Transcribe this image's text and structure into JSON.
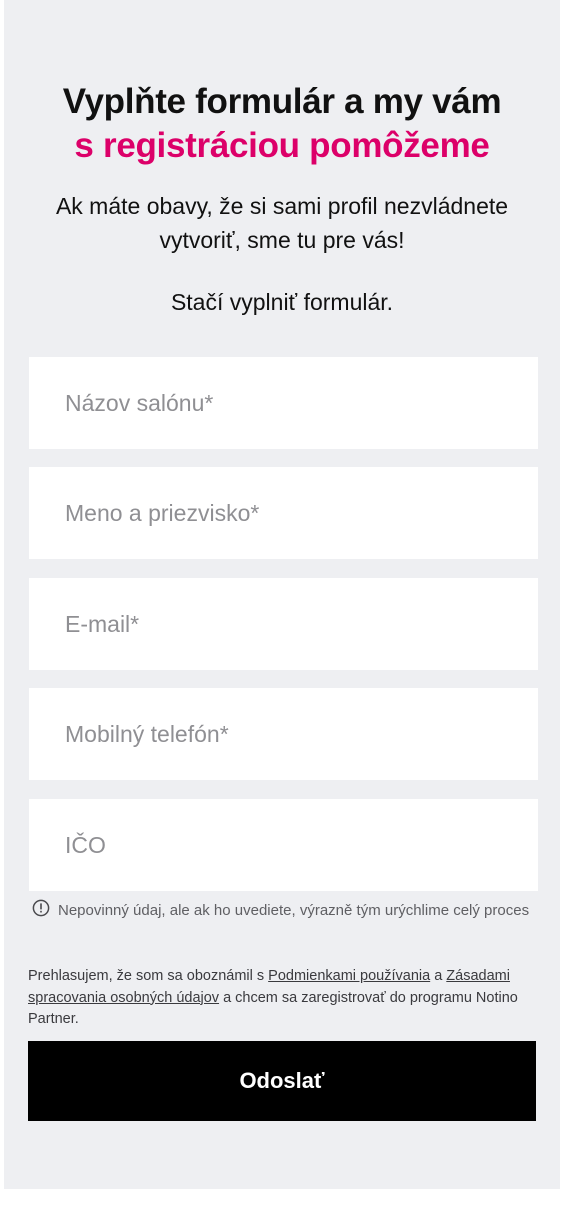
{
  "heading": {
    "line1": "Vyplňte formulár a my vám",
    "line2": "s registráciou pomôžeme"
  },
  "intro": "Ak máte obavy, že si sami profil nezvládnete vytvoriť, sme tu pre vás!",
  "cta": "Stačí vyplniť formulár.",
  "form": {
    "salon_name": {
      "placeholder": "Názov salónu*",
      "value": ""
    },
    "full_name": {
      "placeholder": "Meno a priezvisko*",
      "value": ""
    },
    "email": {
      "placeholder": "E-mail*",
      "value": ""
    },
    "phone": {
      "placeholder": "Mobilný telefón*",
      "value": ""
    },
    "ico": {
      "placeholder": "IČO",
      "value": ""
    }
  },
  "hint": {
    "icon": "info-icon",
    "text": "Nepovinný údaj, ale ak ho uvediete, výrazně tým urýchlime celý proces"
  },
  "consent": {
    "prefix": "Prehlasujem, že som sa oboznámil s ",
    "terms_link": "Podmienkami používania",
    "middle": " a ",
    "privacy_link": "Zásadami spracovania osobných údajov",
    "suffix": " a chcem sa zaregistrovať do programu Notino Partner."
  },
  "submit_label": "Odoslať",
  "colors": {
    "accent": "#dc0069",
    "panel_bg": "#eeeff2",
    "button_bg": "#000000"
  }
}
